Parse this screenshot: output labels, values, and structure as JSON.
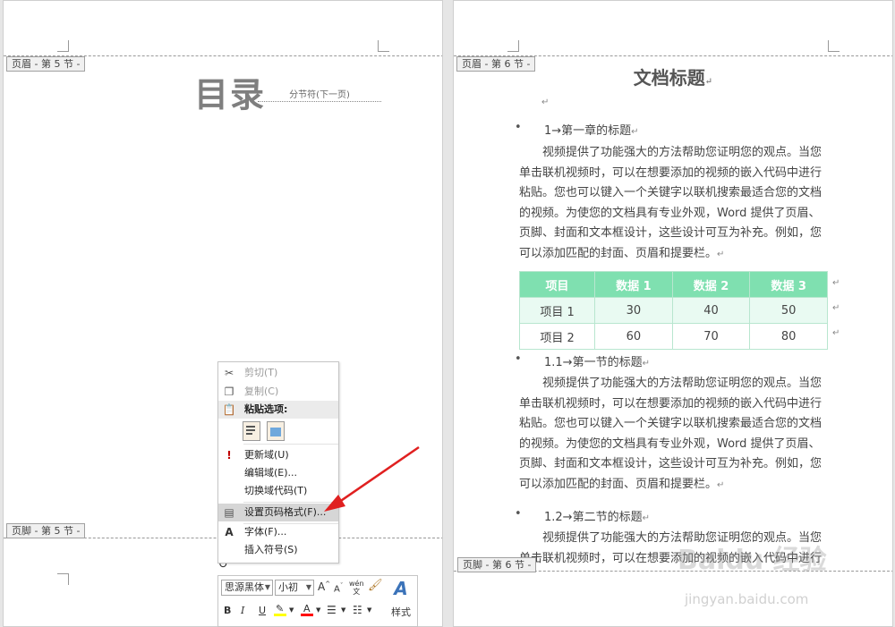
{
  "left_page": {
    "header_tag": "页眉 - 第 5 节 -",
    "footer_tag": "页脚 - 第 5 节 -",
    "title": "目录",
    "section_break": "分节符(下一页)"
  },
  "right_page": {
    "header_tag": "页眉 - 第 6 节 -",
    "footer_tag": "页脚 - 第 6 节 -",
    "doc_title": "文档标题",
    "paragraph_mark": "↵",
    "headings": [
      "1→第一章的标题",
      "1.1→第一节的标题",
      "1.2→第二节的标题"
    ],
    "paragraph_lines": [
      "视频提供了功能强大的方法帮助您证明您的观点。当您",
      "单击联机视频时，可以在想要添加的视频的嵌入代码中进行",
      "粘贴。您也可以键入一个关键字以联机搜索最适合您的文档",
      "的视频。为使您的文档具有专业外观，Word 提供了页眉、",
      "页脚、封面和文本框设计，这些设计可互为补充。例如，您",
      "可以添加匹配的封面、页眉和提要栏。"
    ],
    "partial_paragraph_lines": [
      "视频提供了功能强大的方法帮助您证明您的观点。当您",
      "单击联机视频时，可以在想要添加的视频的嵌入代码中进行"
    ],
    "table": {
      "headers": [
        "项目",
        "数据 1",
        "数据 2",
        "数据 3"
      ],
      "rows": [
        [
          "项目 1",
          "30",
          "40",
          "50"
        ],
        [
          "项目 2",
          "60",
          "70",
          "80"
        ]
      ]
    }
  },
  "context_menu": {
    "cut": "剪切(T)",
    "copy": "复制(C)",
    "paste_options": "粘贴选项:",
    "update_field": "更新域(U)",
    "edit_field": "编辑域(E)...",
    "toggle_field_codes": "切换域代码(T)",
    "format_page_numbers": "设置页码格式(F)...",
    "font": "字体(F)...",
    "insert_symbol": "插入符号(S)"
  },
  "mini_toolbar": {
    "font_name": "思源黑体",
    "font_size": "小初",
    "bold": "B",
    "italic": "I",
    "underline": "U",
    "styles": "样式",
    "phonetic": "wén",
    "highlight_color": "#ffff00",
    "font_color": "#ff0000"
  },
  "watermark": {
    "text": "Baidu 经验",
    "url": "jingyan.baidu.com"
  },
  "colors": {
    "table_header": "#7fe0b0",
    "arrow": "#e02020",
    "menu_hover": "#d6d6d6"
  }
}
